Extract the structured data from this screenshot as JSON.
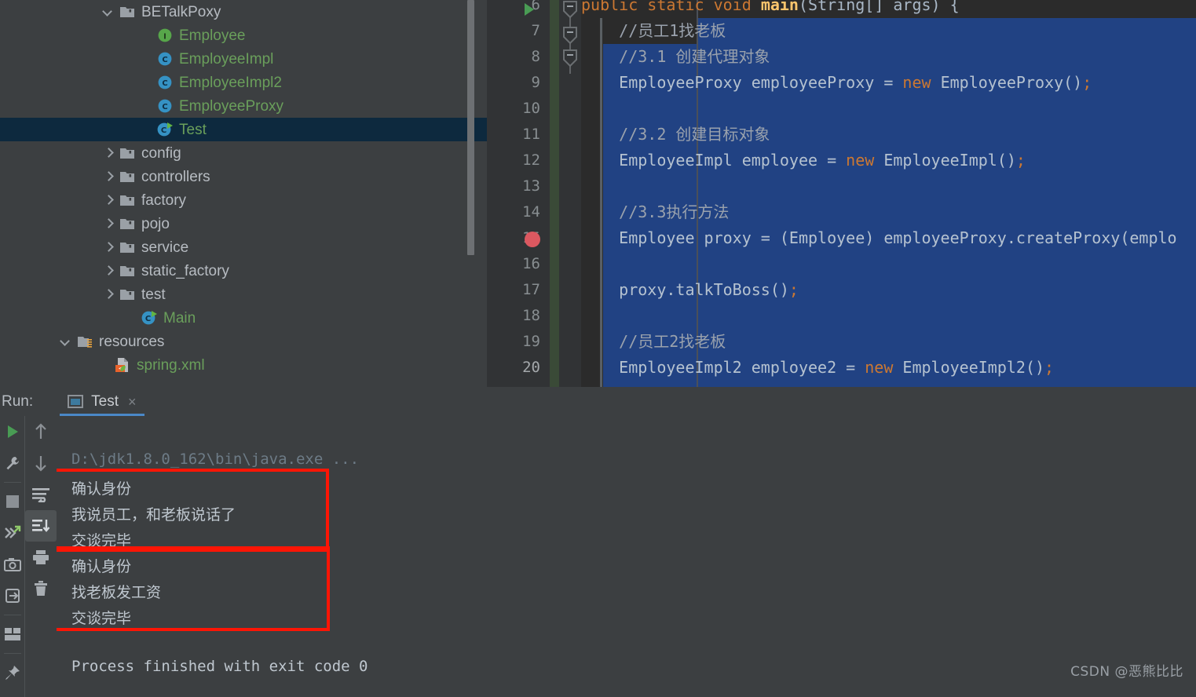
{
  "project_tree": {
    "items": [
      {
        "label": "BETalkPoxy",
        "indent": 130,
        "arrow": "down",
        "icon": "package-folder-icon",
        "style": "plain",
        "selected": false
      },
      {
        "label": "Employee",
        "indent": 178,
        "arrow": "none",
        "icon": "interface-icon",
        "style": "green",
        "selected": false
      },
      {
        "label": "EmployeeImpl",
        "indent": 178,
        "arrow": "none",
        "icon": "class-icon",
        "style": "green",
        "selected": false
      },
      {
        "label": "EmployeeImpl2",
        "indent": 178,
        "arrow": "none",
        "icon": "class-icon",
        "style": "green",
        "selected": false
      },
      {
        "label": "EmployeeProxy",
        "indent": 178,
        "arrow": "none",
        "icon": "class-icon",
        "style": "green",
        "selected": false
      },
      {
        "label": "Test",
        "indent": 178,
        "arrow": "none",
        "icon": "runnable-class-icon",
        "style": "green",
        "selected": true
      },
      {
        "label": "config",
        "indent": 130,
        "arrow": "right",
        "icon": "package-folder-icon",
        "style": "plain",
        "selected": false
      },
      {
        "label": "controllers",
        "indent": 130,
        "arrow": "right",
        "icon": "package-folder-icon",
        "style": "plain",
        "selected": false
      },
      {
        "label": "factory",
        "indent": 130,
        "arrow": "right",
        "icon": "package-folder-icon",
        "style": "plain",
        "selected": false
      },
      {
        "label": "pojo",
        "indent": 130,
        "arrow": "right",
        "icon": "package-folder-icon",
        "style": "plain",
        "selected": false
      },
      {
        "label": "service",
        "indent": 130,
        "arrow": "right",
        "icon": "package-folder-icon",
        "style": "plain",
        "selected": false
      },
      {
        "label": "static_factory",
        "indent": 130,
        "arrow": "right",
        "icon": "package-folder-icon",
        "style": "plain",
        "selected": false
      },
      {
        "label": "test",
        "indent": 130,
        "arrow": "right",
        "icon": "package-folder-icon",
        "style": "plain",
        "selected": false
      },
      {
        "label": "Main",
        "indent": 158,
        "arrow": "none",
        "icon": "runnable-class-icon",
        "style": "green",
        "selected": false
      },
      {
        "label": "resources",
        "indent": 76,
        "arrow": "down",
        "icon": "resources-folder-icon",
        "style": "plain",
        "selected": false
      },
      {
        "label": "spring.xml",
        "indent": 124,
        "arrow": "none",
        "icon": "spring-xml-icon",
        "style": "green",
        "selected": false
      }
    ]
  },
  "editor": {
    "line_numbers": [
      "6",
      "7",
      "8",
      "9",
      "10",
      "11",
      "12",
      "13",
      "14",
      "15",
      "16",
      "17",
      "18",
      "19",
      "20"
    ],
    "current_line_number": "20",
    "breakpoint_line": "15",
    "run_marker_line": "6",
    "lines": [
      {
        "n": "6",
        "segments": [
          {
            "t": "public ",
            "c": "kw"
          },
          {
            "t": "static ",
            "c": "kw"
          },
          {
            "t": "void ",
            "c": "kw"
          },
          {
            "t": "main",
            "c": "mth"
          },
          {
            "t": "(String[] args) {",
            "c": "txt"
          }
        ]
      },
      {
        "n": "7",
        "segments": [
          {
            "t": "    //员工1找老板",
            "c": "cmt-sel"
          }
        ]
      },
      {
        "n": "8",
        "segments": [
          {
            "t": "    //3.1 创建代理对象",
            "c": "cmt-sel"
          }
        ]
      },
      {
        "n": "9",
        "segments": [
          {
            "t": "    EmployeeProxy employeeProxy = ",
            "c": "txt-sel"
          },
          {
            "t": "new ",
            "c": "kw"
          },
          {
            "t": "EmployeeProxy()",
            "c": "txt-sel"
          },
          {
            "t": ";",
            "c": "semi"
          }
        ]
      },
      {
        "n": "10",
        "segments": []
      },
      {
        "n": "11",
        "segments": [
          {
            "t": "    //3.2 创建目标对象",
            "c": "cmt-sel"
          }
        ]
      },
      {
        "n": "12",
        "segments": [
          {
            "t": "    EmployeeImpl employee = ",
            "c": "txt-sel"
          },
          {
            "t": "new ",
            "c": "kw"
          },
          {
            "t": "EmployeeImpl()",
            "c": "txt-sel"
          },
          {
            "t": ";",
            "c": "semi"
          }
        ]
      },
      {
        "n": "13",
        "segments": []
      },
      {
        "n": "14",
        "segments": [
          {
            "t": "    //3.3执行方法",
            "c": "cmt-sel"
          }
        ]
      },
      {
        "n": "15",
        "segments": [
          {
            "t": "    Employee proxy = (Employee) employeeProxy.createProxy(emplo",
            "c": "txt-sel"
          }
        ]
      },
      {
        "n": "16",
        "segments": []
      },
      {
        "n": "17",
        "segments": [
          {
            "t": "    proxy.talkToBoss()",
            "c": "txt-sel"
          },
          {
            "t": ";",
            "c": "semi"
          }
        ]
      },
      {
        "n": "18",
        "segments": []
      },
      {
        "n": "19",
        "segments": [
          {
            "t": "    //员工2找老板",
            "c": "cmt-sel"
          }
        ]
      },
      {
        "n": "20",
        "segments": [
          {
            "t": "    EmployeeImpl2 employee2 = ",
            "c": "txt-sel"
          },
          {
            "t": "new ",
            "c": "kw"
          },
          {
            "t": "EmployeeImpl2()",
            "c": "txt-sel"
          },
          {
            "t": ";",
            "c": "semi"
          }
        ]
      }
    ]
  },
  "run_panel": {
    "run_label": "Run:",
    "tab_label": "Test",
    "tab_close": "×",
    "toolbar_left": [
      {
        "name": "rerun-button",
        "title": "Rerun"
      },
      {
        "name": "edit-config-button",
        "title": "Edit Configuration"
      },
      {
        "name": "stop-button",
        "title": "Stop"
      },
      {
        "name": "rerun-failed-tests-button",
        "title": "Rerun Failed Tests"
      },
      {
        "name": "screenshot-button",
        "title": "Screenshot"
      },
      {
        "name": "export-button",
        "title": "Export"
      },
      {
        "name": "layout-button",
        "title": "Layout"
      },
      {
        "name": "pin-button",
        "title": "Pin Tab"
      }
    ],
    "toolbar_console": [
      {
        "name": "up-arrow-button",
        "title": "Up the Stack Trace"
      },
      {
        "name": "down-arrow-button",
        "title": "Down the Stack Trace"
      },
      {
        "name": "soft-wrap-button",
        "title": "Use Soft Wraps"
      },
      {
        "name": "scroll-to-end-button",
        "title": "Scroll to the End",
        "active": true
      },
      {
        "name": "print-button",
        "title": "Print"
      },
      {
        "name": "trash-button",
        "title": "Clear All"
      }
    ],
    "console": {
      "command_line": "D:\\jdk1.8.0_162\\bin\\java.exe ...",
      "block_one": [
        "确认身份",
        "我说员工，和老板说话了",
        "交谈完毕"
      ],
      "block_two": [
        "确认身份",
        "找老板发工资",
        "交谈完毕"
      ],
      "exit_line": "Process finished with exit code 0"
    }
  },
  "watermark": "CSDN @恶熊比比",
  "colors": {
    "background": "#3c3f41",
    "editor_background": "#2b2b2b",
    "gutter": "#313335",
    "selection_blue": "#214283",
    "tree_selection": "#0d293e",
    "accent_blue": "#4a88c7",
    "green": "#6a9f5b",
    "keyword_orange": "#cc7832",
    "method_yellow": "#ffc66d",
    "red_highlight": "#fc1505",
    "breakpoint_red": "#db5860",
    "vcs_green": "#3a4a37"
  }
}
